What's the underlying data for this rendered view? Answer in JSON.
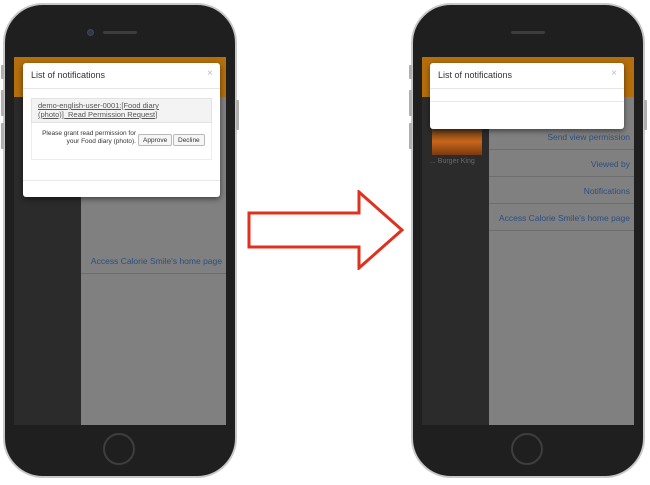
{
  "modal": {
    "title": "List of notifications",
    "close_label": "×"
  },
  "notification": {
    "title": "demo-english-user-0001:[Food diary (photo)]_Read Permission Request]",
    "message": "Please grant read permission for your Food diary (photo).",
    "approve_label": "Approve",
    "decline_label": "Decline"
  },
  "left_screen": {
    "nav_items": [
      "Access Calorie Smile's home page"
    ]
  },
  "right_screen": {
    "thumbnail_caption": "... Burger King",
    "nav_items": [
      "Send view permission",
      "Viewed by",
      "Notifications",
      "Access Calorie Smile's home page"
    ]
  },
  "colors": {
    "header_accent": "#b46e0c",
    "nav_panel": "#808080",
    "nav_link": "#2a4f83",
    "arrow_stroke": "#e0301e"
  },
  "icons": {
    "close": "close-icon",
    "arrow": "arrow-right-icon"
  }
}
